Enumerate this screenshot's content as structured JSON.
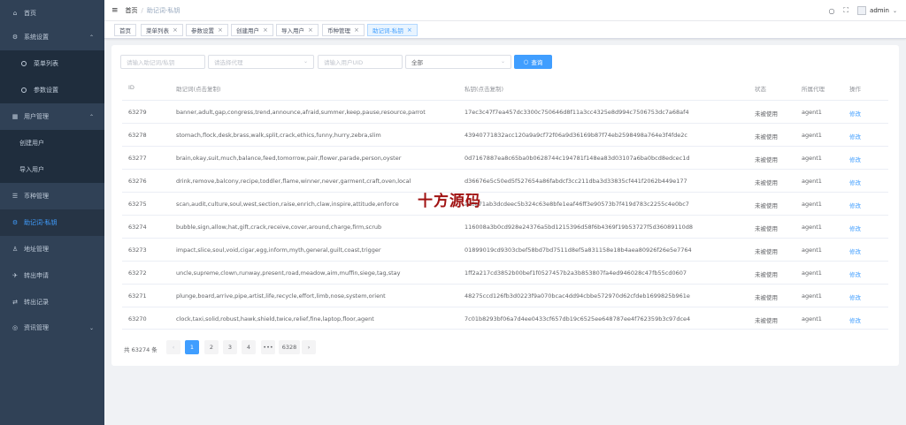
{
  "sidebar": {
    "items": [
      {
        "label": "首页",
        "icon": "home-icon",
        "glyph": "⌂"
      },
      {
        "label": "系统设置",
        "icon": "settings-icon",
        "glyph": "⚙",
        "arrow": "⌃"
      },
      {
        "label": "菜单列表",
        "icon": "circle-icon"
      },
      {
        "label": "参数设置",
        "icon": "circle-icon"
      },
      {
        "label": "用户管理",
        "icon": "grid-icon",
        "glyph": "▦",
        "arrow": "⌃"
      },
      {
        "label": "创建用户"
      },
      {
        "label": "导入用户"
      },
      {
        "label": "币种管理",
        "icon": "sliders-icon",
        "glyph": "☰"
      },
      {
        "label": "助记词-私钥",
        "icon": "gear-icon",
        "glyph": "⚙"
      },
      {
        "label": "地址管理",
        "icon": "user-icon",
        "glyph": "♙"
      },
      {
        "label": "转出申请",
        "icon": "send-icon",
        "glyph": "✈"
      },
      {
        "label": "转出记录",
        "icon": "handshake-icon",
        "glyph": "⇄"
      },
      {
        "label": "资讯管理",
        "icon": "chat-icon",
        "glyph": "◎",
        "arrow": "⌄"
      }
    ]
  },
  "navbar": {
    "breadcrumb_home": "首页",
    "breadcrumb_sep": "/",
    "breadcrumb_current": "助记词-私钥",
    "search_glyph": "○",
    "fullscreen_glyph": "⛶",
    "user_name": "admin",
    "user_caret": "⌄"
  },
  "tabs": [
    {
      "label": "首页",
      "close": ""
    },
    {
      "label": "菜单列表",
      "close": "×"
    },
    {
      "label": "参数设置",
      "close": "×"
    },
    {
      "label": "创建用户",
      "close": "×"
    },
    {
      "label": "导入用户",
      "close": "×"
    },
    {
      "label": "币种管理",
      "close": "×"
    },
    {
      "label": "助记词-私钥",
      "close": "×"
    }
  ],
  "filters": {
    "mnemonic_placeholder": "请输入助记词/私钥",
    "agent_placeholder": "请选择代理",
    "uid_placeholder": "请输入用户UID",
    "status_value": "全部",
    "caret": "⌄",
    "search_label": "查询",
    "search_glyph": "○"
  },
  "table": {
    "headers": {
      "id": "ID",
      "mnemonic": "助记词(点击复制)",
      "private_key": "私钥(点击复制)",
      "status": "状态",
      "agent": "所属代理",
      "action": "操作"
    },
    "rows": [
      {
        "id": "63279",
        "mnemonic": "banner,adult,gap,congress,trend,announce,afraid,summer,keep,pause,resource,parrot",
        "key": "17ec3c47f7ea457dc3300c750646d8f11a3cc4325e8d994c7506753dc7a68af4",
        "status": "未被使用",
        "agent": "agent1",
        "action": "修改"
      },
      {
        "id": "63278",
        "mnemonic": "stomach,flock,desk,brass,walk,split,crack,ethics,funny,hurry,zebra,slim",
        "key": "43940771832acc120a9a9cf72f06a9d36169b87f74eb2598498a764e3f4fde2c",
        "status": "未被使用",
        "agent": "agent1",
        "action": "修改"
      },
      {
        "id": "63277",
        "mnemonic": "brain,okay,suit,much,balance,feed,tomorrow,pair,flower,parade,person,oyster",
        "key": "0d7167887ea8c65ba0b0628744c194781f148ea83d03107a6ba0bcd8edcec1d",
        "status": "未被使用",
        "agent": "agent1",
        "action": "修改"
      },
      {
        "id": "63276",
        "mnemonic": "drink,remove,balcony,recipe,toddler,flame,winner,never,garment,craft,oven,local",
        "key": "d36676e5c50ed5f527654a86fabdcf3cc211dba3d33835cf441f2062b449e177",
        "status": "未被使用",
        "agent": "agent1",
        "action": "修改"
      },
      {
        "id": "63275",
        "mnemonic": "scan,audit,culture,soul,west,section,raise,enrich,claw,inspire,attitude,enforce",
        "key": "ac6e71ab3dcdeec5b324c63e8bfe1eaf46ff3e90573b7f419d783c2255c4e0bc7",
        "status": "未被使用",
        "agent": "agent1",
        "action": "修改"
      },
      {
        "id": "63274",
        "mnemonic": "bubble,sign,allow,hat,gift,crack,receive,cover,around,charge,firm,scrub",
        "key": "116008a3b0cd928e24376a5bd1215396d58f6b4369f19b53727f5d36089110d8",
        "status": "未被使用",
        "agent": "agent1",
        "action": "修改"
      },
      {
        "id": "63273",
        "mnemonic": "impact,slice,soul,void,cigar,egg,inform,myth,general,guilt,coast,trigger",
        "key": "01899019cd9303cbef58bd7bd7511d8ef5a831158e18b4aea80926f26e5e7764",
        "status": "未被使用",
        "agent": "agent1",
        "action": "修改"
      },
      {
        "id": "63272",
        "mnemonic": "uncle,supreme,clown,runway,present,road,meadow,aim,muffin,siege,tag,stay",
        "key": "1ff2a217cd3852b00bef1f0527457b2a3b853807fa4ed946028c47fb55cd0607",
        "status": "未被使用",
        "agent": "agent1",
        "action": "修改"
      },
      {
        "id": "63271",
        "mnemonic": "plunge,board,arrive,pipe,artist,life,recycle,effort,limb,nose,system,orient",
        "key": "48275ccd126fb3d0223f9a070bcac4dd94cbbe572970d62cfdeb1699825b961e",
        "status": "未被使用",
        "agent": "agent1",
        "action": "修改"
      },
      {
        "id": "63270",
        "mnemonic": "clock,taxi,solid,robust,hawk,shield,twice,relief,fine,laptop,floor,agent",
        "key": "7c01b8293bf06a7d4ee0433cf657db19c6525ee648787ee4f762359b3c97dce4",
        "status": "未被使用",
        "agent": "agent1",
        "action": "修改"
      }
    ]
  },
  "pagination": {
    "total_label": "共 63274 条",
    "prev": "‹",
    "next": "›",
    "pages": [
      "1",
      "2",
      "3",
      "4",
      "•••",
      "6328"
    ],
    "current": "1"
  },
  "watermark": "十方源码",
  "colors": {
    "sidebar_bg": "#304156",
    "accent": "#409eff",
    "watermark": "#a01212"
  }
}
